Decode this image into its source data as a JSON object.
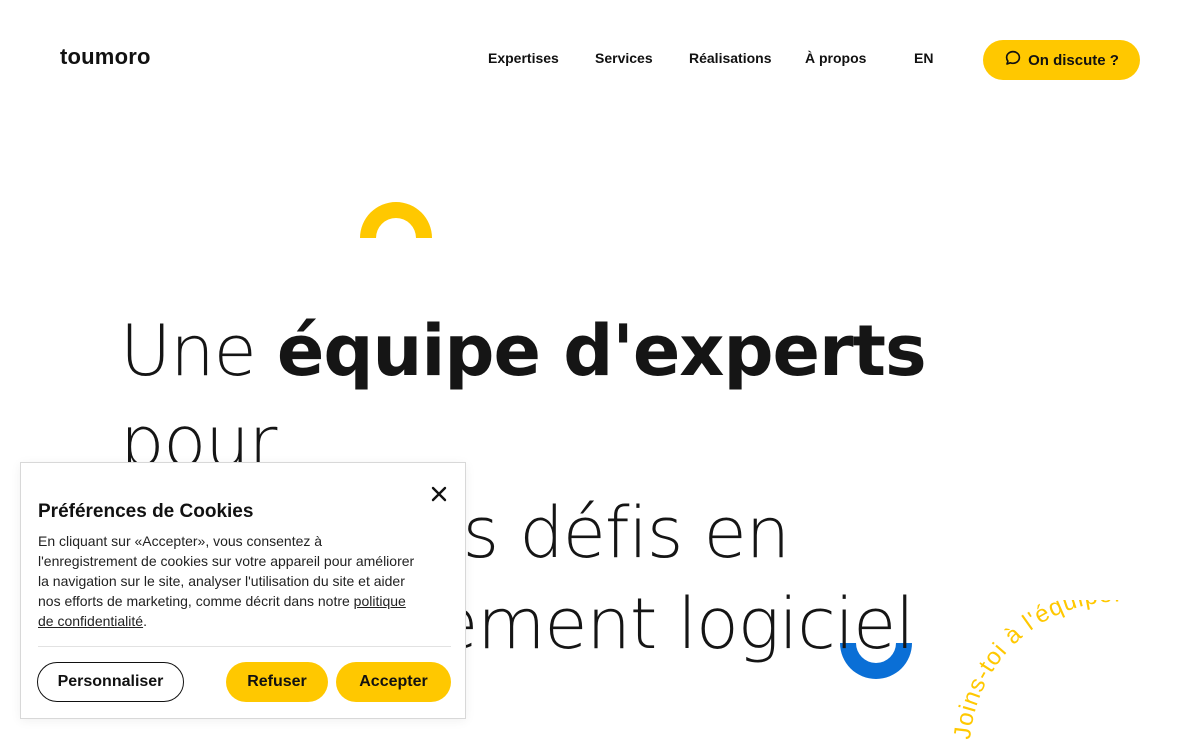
{
  "brand": {
    "logo_text": "toumoro"
  },
  "nav": {
    "items": [
      {
        "label": "Expertises"
      },
      {
        "label": "Services"
      },
      {
        "label": "Réalisations"
      },
      {
        "label": "À propos"
      }
    ],
    "language": "EN",
    "cta_label": "On discute ?",
    "cta_icon": "chat-bubble-icon"
  },
  "hero": {
    "line1_start": "Une ",
    "line1_bold": "équipe d'experts",
    "line1_end": " pour",
    "line2": "relever vos défis en",
    "line3": "développement logiciel"
  },
  "badge": {
    "curved_text": "Joins-toi à l'équipe!"
  },
  "cookie_banner": {
    "title": "Préférences de Cookies",
    "body": "En cliquant sur «Accepter», vous consentez à l'enregistrement de cookies sur votre appareil pour améliorer la navigation sur le site, analyser l'utilisation du site et aider nos efforts de marketing, comme décrit dans notre ",
    "link_text": "politique de confidentialité",
    "body_end": ".",
    "customize_label": "Personnaliser",
    "refuse_label": "Refuser",
    "accept_label": "Accepter",
    "close_icon": "close-icon"
  },
  "colors": {
    "accent_yellow": "#FFC800",
    "accent_blue": "#0A6FD6",
    "text_dark": "#111111"
  }
}
